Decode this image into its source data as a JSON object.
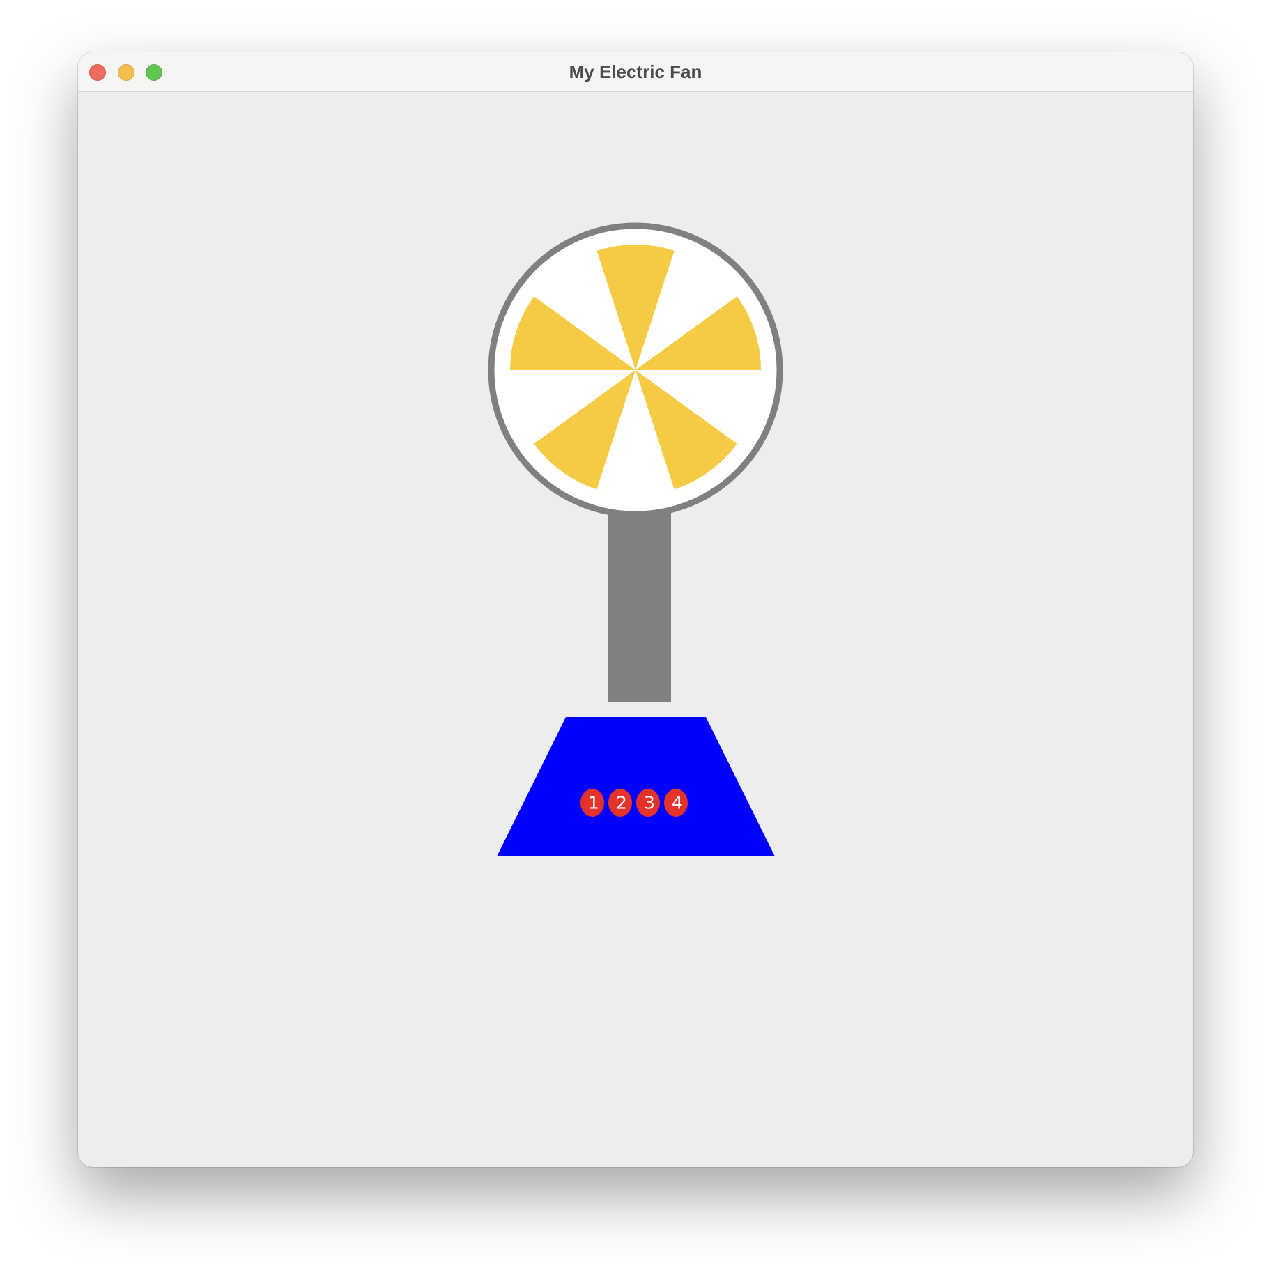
{
  "window": {
    "title": "My Electric Fan",
    "controls": [
      "close-button",
      "minimize-button",
      "zoom-button"
    ]
  },
  "colors": {
    "close": "#ed6a5e",
    "minimize": "#f4bf4f",
    "zoom": "#61c554",
    "fan_guard": "#808080",
    "fan_face": "#ffffff",
    "blades": "#f5cb45",
    "pole": "#808080",
    "base": "#0000ff",
    "speed_button": "#e5322b",
    "speed_text": "#ffffff"
  },
  "fan": {
    "blade_count": 5,
    "speed_buttons": [
      {
        "label": "1"
      },
      {
        "label": "2"
      },
      {
        "label": "3"
      },
      {
        "label": "4"
      }
    ]
  }
}
